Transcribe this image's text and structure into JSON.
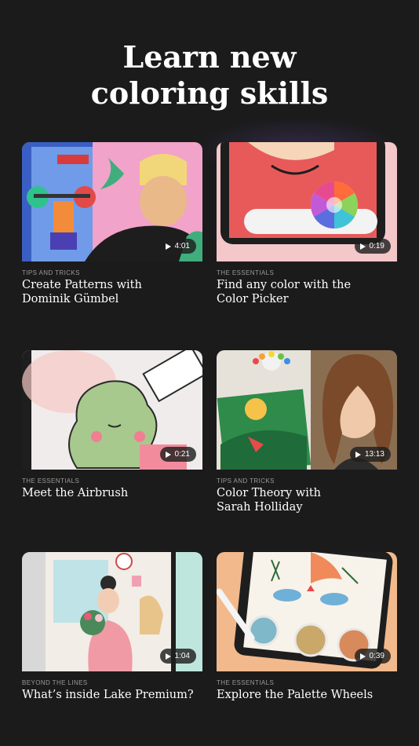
{
  "headline": {
    "line1": "Learn new",
    "line2": "coloring skills"
  },
  "cards": [
    {
      "category": "TIPS AND TRICKS",
      "title_line1": "Create Patterns with",
      "title_line2": "Dominik Gümbel",
      "duration": "4:01"
    },
    {
      "category": "THE ESSENTIALS",
      "title_line1": "Find any color with the",
      "title_line2": "Color Picker",
      "duration": "0:19"
    },
    {
      "category": "THE ESSENTIALS",
      "title_line1": "Meet the Airbrush",
      "title_line2": "",
      "duration": "0:21"
    },
    {
      "category": "TIPS AND TRICKS",
      "title_line1": "Color Theory with",
      "title_line2": "Sarah Holliday",
      "duration": "13:13"
    },
    {
      "category": "BEYOND THE LINES",
      "title_line1": "What’s inside Lake Premium?",
      "title_line2": "",
      "duration": "1:04"
    },
    {
      "category": "THE ESSENTIALS",
      "title_line1": "Explore the Palette Wheels",
      "title_line2": "",
      "duration": "0:39"
    }
  ],
  "icons": {
    "play": "play-icon"
  },
  "colors": {
    "background": "#1b1b1c",
    "card": "#242425",
    "category_text": "#9a9a9a"
  }
}
